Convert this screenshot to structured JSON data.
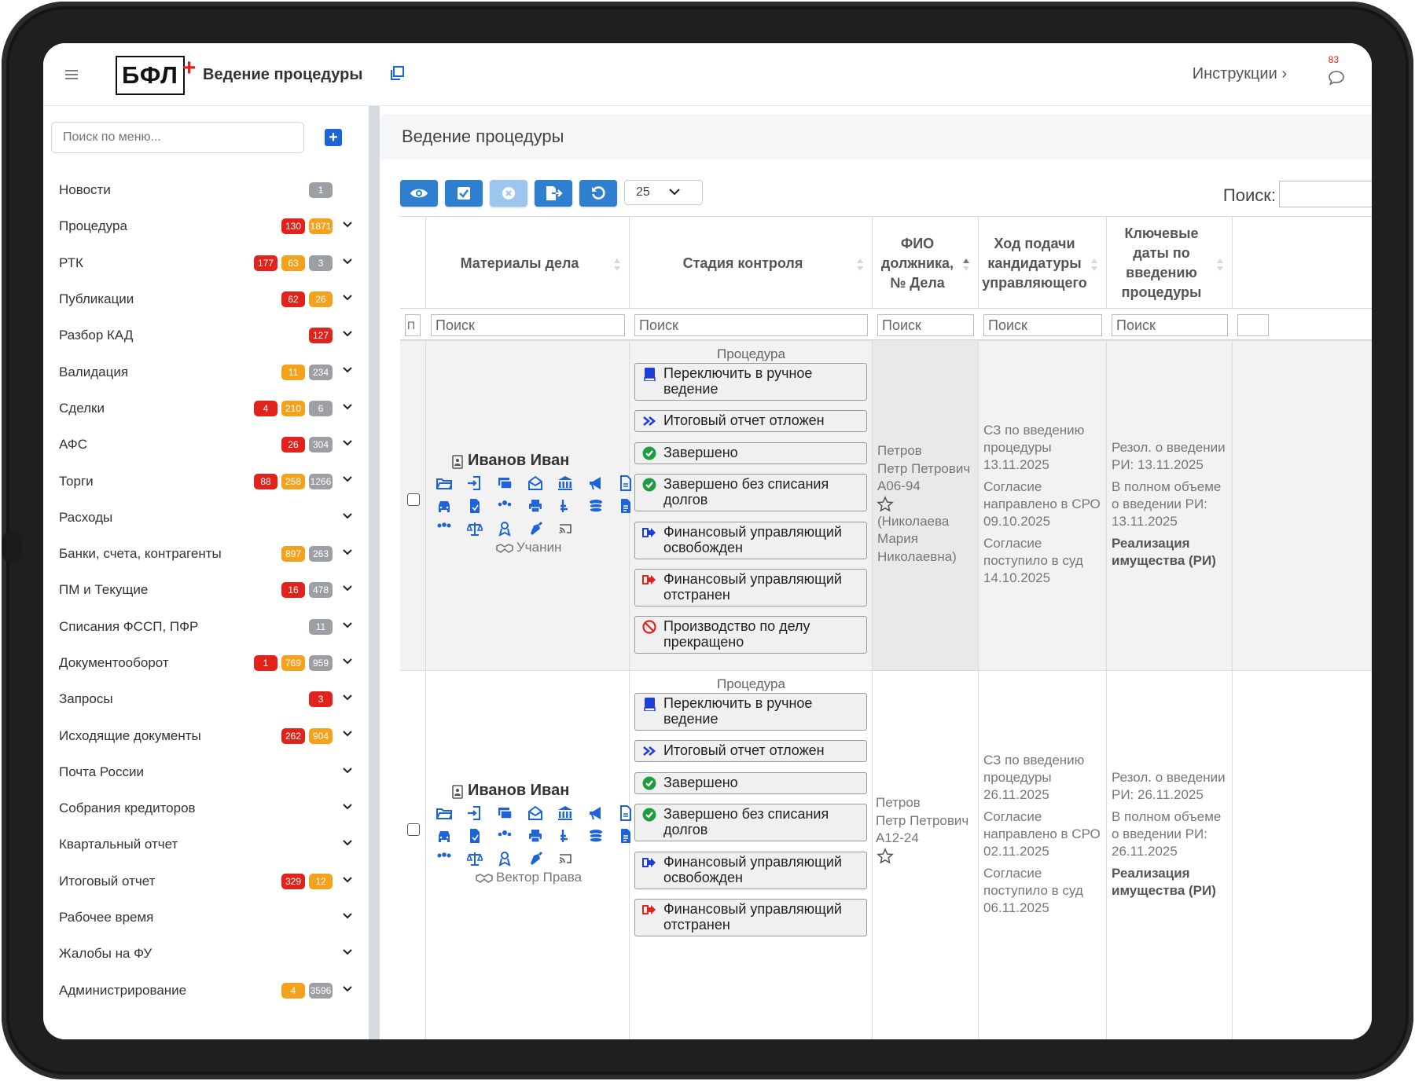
{
  "header": {
    "logo_text": "БФЛ",
    "logo_plus": "+",
    "app_title": "Ведение процедуры",
    "instructions": "Инструкции ›",
    "notifications_count": "83"
  },
  "sidebar": {
    "search_placeholder": "Поиск по меню...",
    "items": [
      {
        "label": "Новости",
        "badges": [
          {
            "v": "1",
            "c": "gray"
          }
        ],
        "chevron": false
      },
      {
        "label": "Процедура",
        "badges": [
          {
            "v": "130",
            "c": "red"
          },
          {
            "v": "1871",
            "c": "orange"
          }
        ],
        "chevron": true
      },
      {
        "label": "РТК",
        "badges": [
          {
            "v": "177",
            "c": "red"
          },
          {
            "v": "63",
            "c": "orange"
          },
          {
            "v": "3",
            "c": "gray"
          }
        ],
        "chevron": true
      },
      {
        "label": "Публикации",
        "badges": [
          {
            "v": "62",
            "c": "red"
          },
          {
            "v": "26",
            "c": "orange"
          }
        ],
        "chevron": true
      },
      {
        "label": "Разбор КАД",
        "badges": [
          {
            "v": "127",
            "c": "red"
          }
        ],
        "chevron": true
      },
      {
        "label": "Валидация",
        "badges": [
          {
            "v": "11",
            "c": "orange"
          },
          {
            "v": "234",
            "c": "gray"
          }
        ],
        "chevron": true
      },
      {
        "label": "Сделки",
        "badges": [
          {
            "v": "4",
            "c": "red"
          },
          {
            "v": "210",
            "c": "orange"
          },
          {
            "v": "6",
            "c": "gray"
          }
        ],
        "chevron": true
      },
      {
        "label": "АФС",
        "badges": [
          {
            "v": "26",
            "c": "red"
          },
          {
            "v": "304",
            "c": "gray"
          }
        ],
        "chevron": true
      },
      {
        "label": "Торги",
        "badges": [
          {
            "v": "88",
            "c": "red"
          },
          {
            "v": "258",
            "c": "orange"
          },
          {
            "v": "1266",
            "c": "gray"
          }
        ],
        "chevron": true
      },
      {
        "label": "Расходы",
        "badges": [],
        "chevron": true
      },
      {
        "label": "Банки, счета, контрагенты",
        "badges": [
          {
            "v": "897",
            "c": "orange"
          },
          {
            "v": "263",
            "c": "gray"
          }
        ],
        "chevron": true
      },
      {
        "label": "ПМ и Текущие",
        "badges": [
          {
            "v": "16",
            "c": "red"
          },
          {
            "v": "478",
            "c": "gray"
          }
        ],
        "chevron": true
      },
      {
        "label": "Списания ФССП, ПФР",
        "badges": [
          {
            "v": "11",
            "c": "gray"
          }
        ],
        "chevron": true
      },
      {
        "label": "Документооборот",
        "badges": [
          {
            "v": "1",
            "c": "red"
          },
          {
            "v": "769",
            "c": "orange"
          },
          {
            "v": "959",
            "c": "gray"
          }
        ],
        "chevron": true
      },
      {
        "label": "Запросы",
        "badges": [
          {
            "v": "3",
            "c": "red"
          }
        ],
        "chevron": true
      },
      {
        "label": "Исходящие документы",
        "badges": [
          {
            "v": "262",
            "c": "red"
          },
          {
            "v": "904",
            "c": "orange"
          }
        ],
        "chevron": true
      },
      {
        "label": "Почта России",
        "badges": [],
        "chevron": true
      },
      {
        "label": "Собрания кредиторов",
        "badges": [],
        "chevron": true
      },
      {
        "label": "Квартальный отчет",
        "badges": [],
        "chevron": true
      },
      {
        "label": "Итоговый отчет",
        "badges": [
          {
            "v": "329",
            "c": "red"
          },
          {
            "v": "12",
            "c": "orange"
          }
        ],
        "chevron": true
      },
      {
        "label": "Рабочее время",
        "badges": [],
        "chevron": true
      },
      {
        "label": "Жалобы на ФУ",
        "badges": [],
        "chevron": true
      },
      {
        "label": "Администрирование",
        "badges": [
          {
            "v": "4",
            "c": "orange"
          },
          {
            "v": "3596",
            "c": "gray"
          }
        ],
        "chevron": true
      }
    ]
  },
  "main": {
    "title": "Ведение процедуры",
    "page_size": "25",
    "search_label": "Поиск:",
    "filter_placeholder": "Поиск",
    "filter_first": "П",
    "columns": [
      "Материалы дела",
      "Стадия контроля",
      "ФИО должника, № Дела",
      "Ход подачи кандидатуры управляющего",
      "Ключевые даты по введению процедуры"
    ],
    "rows": [
      {
        "debtor": "Иванов Иван",
        "manager": "Учанин",
        "stage_title": "Процедура",
        "stages": [
          "Переключить в ручное ведение",
          "Итоговый отчет отложен",
          "Завершено",
          "Завершено без списания долгов",
          "Финансовый управляющий освобожден",
          "Финансовый управляющий отстранен",
          "Производство по делу прекращено"
        ],
        "fio": [
          "Петров",
          "Петр Петрович",
          "А06-94",
          "(Николаева",
          "Мария",
          "Николаевна)"
        ],
        "candidacy": [
          "СЗ по введению процедуры",
          "13.11.2025",
          "Согласие направлено в СРО",
          "09.10.2025",
          "Согласие поступило в суд",
          "14.10.2025"
        ],
        "key_dates": [
          "Резол. о введении РИ: 13.11.2025",
          "В полном объеме о введении РИ:",
          "13.11.2025",
          "Реализация имущества (РИ)"
        ]
      },
      {
        "debtor": "Иванов Иван",
        "manager": "Вектор Права",
        "stage_title": "Процедура",
        "stages": [
          "Переключить в ручное ведение",
          "Итоговый отчет отложен",
          "Завершено",
          "Завершено без списания долгов",
          "Финансовый управляющий освобожден",
          "Финансовый управляющий отстранен"
        ],
        "fio": [
          "Петров",
          "Петр Петрович",
          "А12-24"
        ],
        "candidacy": [
          "СЗ по введению процедуры",
          "26.11.2025",
          "Согласие направлено в СРО",
          "02.11.2025",
          "Согласие поступило в суд",
          "06.11.2025"
        ],
        "key_dates": [
          "Резол. о введении РИ: 26.11.2025",
          "В полном объеме о введении РИ:",
          "26.11.2025",
          "Реализация имущества (РИ)"
        ]
      }
    ]
  },
  "colors": {
    "accent": "#2f7fd0",
    "red": "#e0241b",
    "orange": "#f4a21d",
    "gray": "#9c9fa3",
    "icon_blue": "#1c64d8"
  }
}
